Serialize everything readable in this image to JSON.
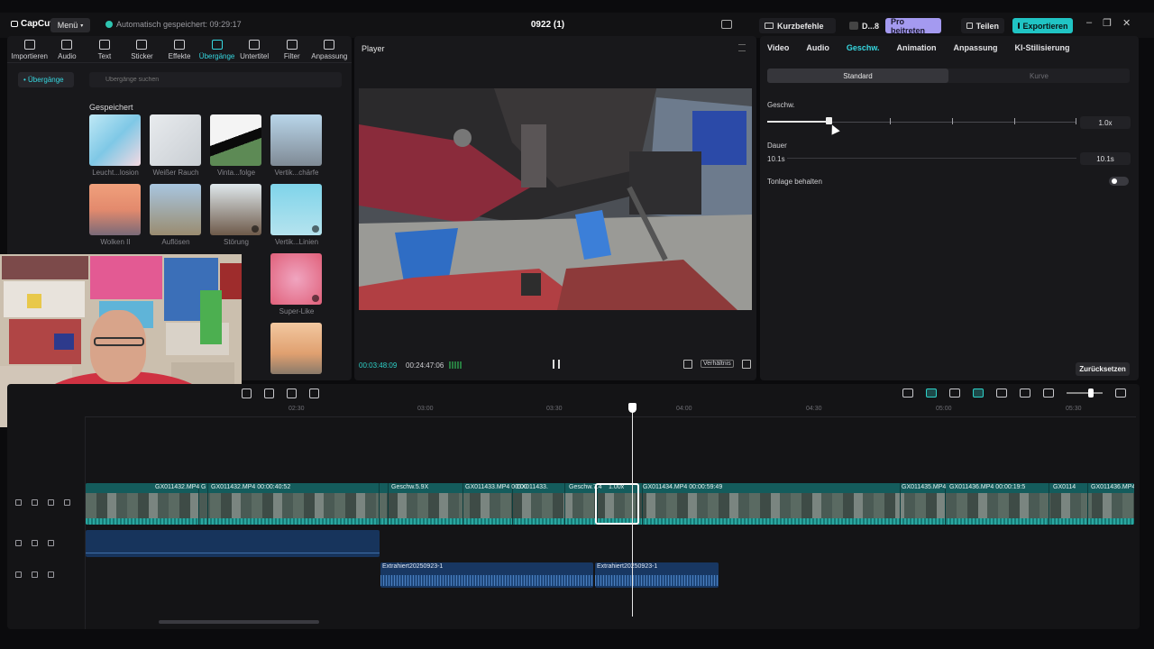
{
  "app": {
    "logo": "CapCut",
    "menu_label": "Menü",
    "autosave": "Automatisch gespeichert: 09:29:17",
    "project_title": "0922 (1)",
    "shortcuts_label": "Kurzbefehle",
    "device_label": "D...8",
    "pro_label": "Pro beitreten",
    "share_label": "Teilen",
    "export_label": "Exportieren"
  },
  "toolbar": {
    "items": [
      {
        "label": "Importieren",
        "icon": "import-icon"
      },
      {
        "label": "Audio",
        "icon": "audio-icon"
      },
      {
        "label": "Text",
        "icon": "text-icon"
      },
      {
        "label": "Sticker",
        "icon": "sticker-icon"
      },
      {
        "label": "Effekte",
        "icon": "effects-icon"
      },
      {
        "label": "Übergänge",
        "icon": "transitions-icon",
        "active": true
      },
      {
        "label": "Untertitel",
        "icon": "subtitle-icon"
      },
      {
        "label": "Filter",
        "icon": "filter-icon"
      },
      {
        "label": "Anpassung",
        "icon": "adjust-icon"
      }
    ]
  },
  "media": {
    "sidebar_item": "• Übergänge",
    "search_placeholder": "Übergänge suchen",
    "section_title": "Gespeichert",
    "transitions": [
      {
        "label": "Leucht...losion"
      },
      {
        "label": "Weißer Rauch"
      },
      {
        "label": "Vinta...folge"
      },
      {
        "label": "Vertik...chärfe"
      },
      {
        "label": "Wolken II"
      },
      {
        "label": "Auflösen"
      },
      {
        "label": "Störung"
      },
      {
        "label": "Vertik...Linien"
      },
      {
        "label": "Super-Like"
      }
    ]
  },
  "player": {
    "title": "Player",
    "current_time": "00:03:48:09",
    "total_time": "00:24:47:06",
    "ratio_label": "Verhältnis"
  },
  "properties": {
    "tabs": [
      "Video",
      "Audio",
      "Geschw.",
      "Animation",
      "Anpassung",
      "KI-Stilisierung"
    ],
    "active_tab": "Geschw.",
    "modes": [
      "Standard",
      "Kurve"
    ],
    "speed_label": "Geschw.",
    "speed_value": "1.0x",
    "duration_label": "Dauer",
    "duration_left": "10.1s",
    "duration_value": "10.1s",
    "pitch_label": "Tonlage behalten",
    "reset_label": "Zurücksetzen"
  },
  "timeline": {
    "ruler": [
      "02:30",
      "03:00",
      "03:30",
      "04:00",
      "04:30",
      "05:00",
      "05:30"
    ],
    "video_clips": [
      "GX011432.MP4",
      "G",
      "GX011432.MP4  00:00:40:52",
      "Geschw.5.9X",
      "GX011433.MP4  00:00",
      "GX011433.",
      "Geschw.7.4",
      "1.00x",
      "GX011434.MP4  00:00:59:49",
      "GX011435.MP4",
      "GX011436.MP4  00:00:19:5",
      "GX0114",
      "GX011436.MP4"
    ],
    "audio_clips": [
      "Extrahiert20250923-1",
      "Extrahiert20250923-1"
    ]
  }
}
